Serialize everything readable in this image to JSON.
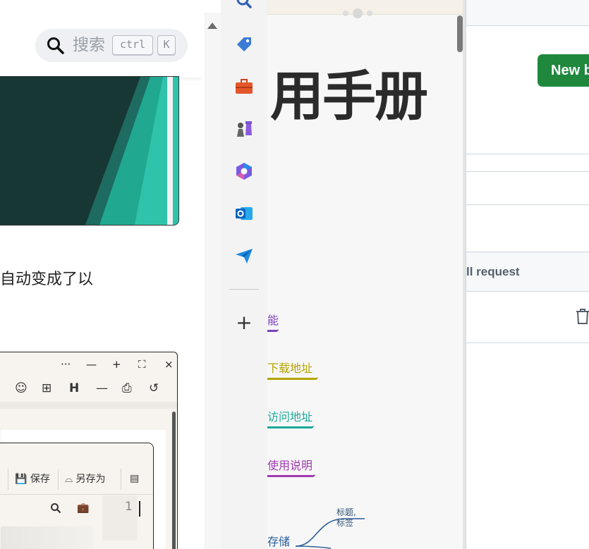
{
  "doc": {
    "search": {
      "placeholder": "搜索",
      "kbd_ctrl": "ctrl",
      "kbd_k": "K"
    },
    "paragraph_fragment": "自动变成了以",
    "editor": {
      "window_controls": [
        "···",
        "—",
        "+",
        "⛶",
        "×"
      ],
      "toolbar_icons": [
        "☺",
        "⊞",
        "H",
        "—",
        "⎙",
        "↺"
      ],
      "save_label": "保存",
      "saveas_label": "另存为",
      "line_number": "1"
    }
  },
  "app_bar": {
    "icons": [
      "search-icon",
      "tag-icon",
      "toolbox-icon",
      "chess-icon",
      "copilot-icon",
      "outlook-icon",
      "send-icon"
    ],
    "add_label": "+"
  },
  "mindmap": {
    "topbar_title": "",
    "title": "用手册",
    "links": [
      {
        "text": "能",
        "color": "#7b3fbf"
      },
      {
        "text": "下载地址",
        "color": "#b5a400"
      },
      {
        "text": "访问地址",
        "color": "#1aa89a"
      },
      {
        "text": "使用说明",
        "color": "#a03ab0"
      },
      {
        "text": "存储",
        "color": "#2a5d9a"
      }
    ],
    "small_node": [
      "标题,",
      "标签"
    ]
  },
  "github": {
    "new_branch_label": "New b",
    "column_label": "ll request"
  }
}
